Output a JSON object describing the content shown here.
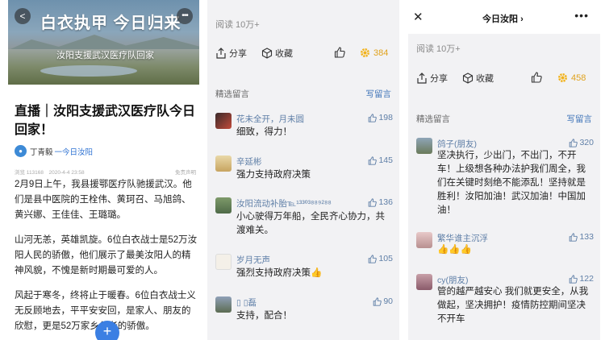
{
  "p1": {
    "hero_title": "白衣执甲 今日归来",
    "hero_sub": "汝阳支援武汉医疗队回家",
    "back": "<",
    "more": "•••",
    "title": "直播｜汝阳支援武汉医疗队今日回家！",
    "author_name": "丁青毅",
    "author_src": "一今日汝阳",
    "meta_left": "浏览 113168　2020-4-4 23:58",
    "meta_right": "免责声明",
    "para1": "2月9日上午，我县援鄂医疗队驰援武汉。他们是县中医院的王栓伟、黄珂召、马旭鸽、黄兴娜、王佳佳、王璐璐。",
    "para2": "山河无恙，英雄凯旋。6位白衣战士是52万汝阳人民的骄傲，他们展示了最美汝阳人的精神风貌，不愧是新时期最可爱的人。",
    "para3": "风起于寒冬，终将止于暖春。6位白衣战士义无反顾地去，平平安安回，是家人、朋友的欣慰，更是52万家乡父老的骄傲。",
    "fab": "+"
  },
  "p2": {
    "read": "阅读 10万+",
    "share": "分享",
    "fav": "收藏",
    "like_count": "384",
    "section": "精选留言",
    "write": "写留言",
    "comments": [
      {
        "name": "花未全开，月未圆",
        "text": "细致，得力！",
        "likes": "198"
      },
      {
        "name": "辛延彬",
        "text": "强力支持政府决策",
        "likes": "145"
      },
      {
        "name": "汝阳流动补胎℡¹³³º³⁸⁸⁹²⁸⁸",
        "text": "小心驶得万年船，全民齐心协力，共渡难关。",
        "likes": "136"
      },
      {
        "name": "岁月无声",
        "text": "强烈支持政府决策👍",
        "likes": "105"
      },
      {
        "name": "▯ ▯磊",
        "text": "支持，配合！",
        "likes": "90"
      }
    ]
  },
  "p3": {
    "close": "✕",
    "title": "今日汝阳",
    "title_arrow": "›",
    "more": "•••",
    "read": "阅读 10万+",
    "share": "分享",
    "fav": "收藏",
    "like_count": "458",
    "section": "精选留言",
    "write": "写留言",
    "comments": [
      {
        "name": "鸽子(朋友)",
        "text": "坚决执行，少出门，不出门，不开车！上级想各种办法护我们周全，我们在关键时刻绝不能添乱！坚持就是胜利！汝阳加油！武汉加油！中国加油！",
        "likes": "320"
      },
      {
        "name": "繁华谁主沉浮",
        "text": "👍👍👍",
        "likes": "133"
      },
      {
        "name": "cy(朋友)",
        "text": "管的越严越安心 我们就更安全，从我做起，坚决拥护！疫情防控期间坚决不开车",
        "likes": "122"
      }
    ]
  },
  "colors": {
    "link": "#5f7fa7",
    "accent_gold": "#f2b21a",
    "gold_text": "#e0a21d"
  }
}
